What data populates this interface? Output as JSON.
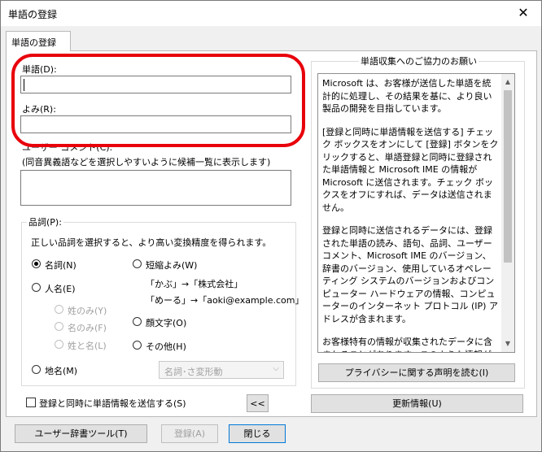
{
  "window": {
    "title": "単語の登録",
    "close": "✕"
  },
  "tab": {
    "label": "単語の登録"
  },
  "word": {
    "label": "単語(D):",
    "value": ""
  },
  "reading": {
    "label": "よみ(R):",
    "value": ""
  },
  "comment": {
    "label": "ユーザー コメント(C):",
    "hint": "(同音異義語などを選択しやすいように候補一覧に表示します)",
    "value": ""
  },
  "pos": {
    "legend": "品詞(P):",
    "description": "正しい品詞を選択すると、より高い変換精度を得られます。",
    "noun": "名詞(N)",
    "person": "人名(E)",
    "surname": "姓のみ(Y)",
    "given": "名のみ(F)",
    "fullname": "姓と名(L)",
    "place": "地名(M)",
    "short": "短縮よみ(W)",
    "example1": "「かぶ」→「株式会社」",
    "example2": "「めーる」→「aoki@example.com」",
    "emoticon": "顔文字(O)",
    "other": "その他(H)",
    "select_value": "名詞･さ変形動"
  },
  "send_checkbox": "登録と同時に単語情報を送信する(S)",
  "collapse_button": "<<",
  "right": {
    "legend": "単語収集へのご協力のお願い",
    "paragraphs": [
      "Microsoft は、お客様が送信した単語を統計的に処理し、その結果を基に、より良い製品の開発を目指しています。",
      "[登録と同時に単語情報を送信する] チェック ボックスをオンにして [登録] ボタンをクリックすると、単語登録と同時に登録された単語情報と Microsoft IME の情報が Microsoft に送信されます。チェック ボックスをオフにすれば、データは送信されません。",
      "登録と同時に送信されるデータには、登録された単語の読み、語句、品詞、ユーザー コメント、Microsoft IME のバージョン、辞書のバージョン、使用しているオペレーティング システムのバージョンおよびコンピューター ハードウェアの情報、コンピューターのインターネット プロトコル (IP) アドレスが含まれます。",
      "お客様特有の情報が収集されたデータに含まれることがあります。このような情報が存在する場合でも、Microsoft では、お客様を特定するために使用することはありません。"
    ],
    "privacy_button": "プライバシーに関する声明を読む(I)",
    "update_button": "更新情報(U)"
  },
  "footer": {
    "tool_button": "ユーザー辞書ツール(T)",
    "register_button": "登録(A)",
    "close_button": "閉じる"
  }
}
